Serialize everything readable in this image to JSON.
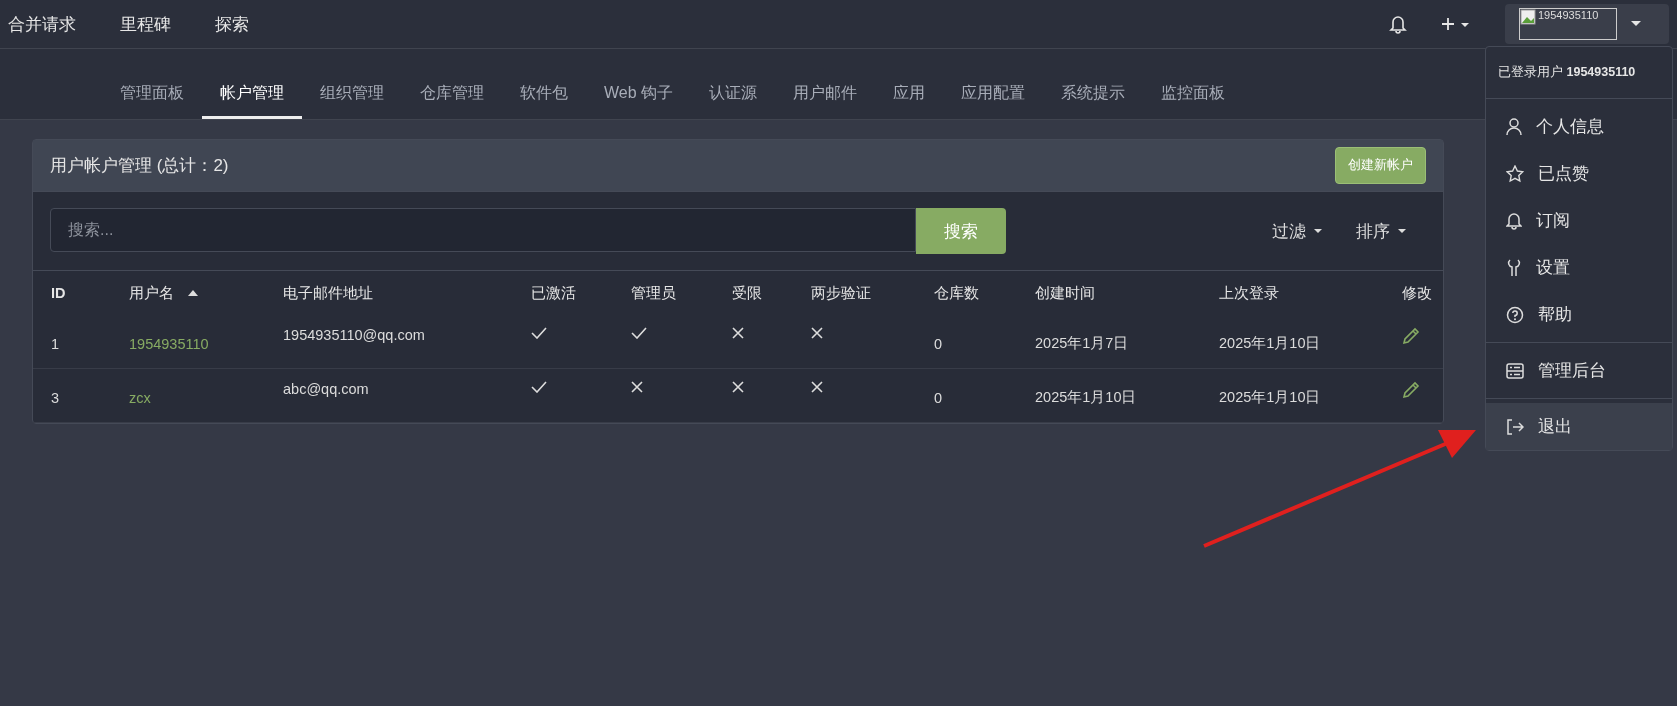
{
  "top_nav": {
    "links": [
      "合并请求",
      "里程碑",
      "探索"
    ],
    "avatar_alt": "1954935110"
  },
  "tabs": [
    {
      "label": "管理面板",
      "selected": false
    },
    {
      "label": "帐户管理",
      "selected": true
    },
    {
      "label": "组织管理",
      "selected": false
    },
    {
      "label": "仓库管理",
      "selected": false
    },
    {
      "label": "软件包",
      "selected": false
    },
    {
      "label": "Web 钩子",
      "selected": false
    },
    {
      "label": "认证源",
      "selected": false
    },
    {
      "label": "用户邮件",
      "selected": false
    },
    {
      "label": "应用",
      "selected": false
    },
    {
      "label": "应用配置",
      "selected": false
    },
    {
      "label": "系统提示",
      "selected": false
    },
    {
      "label": "监控面板",
      "selected": false
    }
  ],
  "panel": {
    "title": "用户帐户管理 (总计：2)",
    "create_button": "创建新帐户",
    "search": {
      "placeholder": "搜索...",
      "button": "搜索"
    },
    "filter": "过滤",
    "sort": "排序"
  },
  "table": {
    "columns": [
      {
        "label": "ID",
        "sorted": false
      },
      {
        "label": "用户名",
        "sorted": true
      },
      {
        "label": "电子邮件地址",
        "sorted": false
      },
      {
        "label": "已激活",
        "sorted": false
      },
      {
        "label": "管理员",
        "sorted": false
      },
      {
        "label": "受限",
        "sorted": false
      },
      {
        "label": "两步验证",
        "sorted": false
      },
      {
        "label": "仓库数",
        "sorted": false
      },
      {
        "label": "创建时间",
        "sorted": false
      },
      {
        "label": "上次登录",
        "sorted": false
      },
      {
        "label": "修改",
        "sorted": false
      }
    ],
    "rows": [
      {
        "id": "1",
        "username": "1954935110",
        "email": "1954935110@qq.com",
        "active": true,
        "admin": true,
        "restricted": false,
        "two_factor": false,
        "repos": "0",
        "created": "2025年1月7日",
        "last_login": "2025年1月10日"
      },
      {
        "id": "3",
        "username": "zcx",
        "email": "abc@qq.com",
        "active": true,
        "admin": false,
        "restricted": false,
        "two_factor": false,
        "repos": "0",
        "created": "2025年1月10日",
        "last_login": "2025年1月10日"
      }
    ]
  },
  "user_menu": {
    "header": "已登录用户 **1954935110**",
    "sections": [
      [
        {
          "kind": "profile",
          "label": "个人信息",
          "selected": false
        },
        {
          "kind": "starred",
          "label": "已点赞",
          "selected": false
        },
        {
          "kind": "subscriptions",
          "label": "订阅",
          "selected": false
        },
        {
          "kind": "settings",
          "label": "设置",
          "selected": false
        },
        {
          "kind": "help",
          "label": "帮助",
          "selected": false
        }
      ],
      [
        {
          "kind": "admin",
          "label": "管理后台",
          "selected": false
        }
      ],
      [
        {
          "kind": "logout",
          "label": "退出",
          "selected": true
        }
      ]
    ]
  }
}
